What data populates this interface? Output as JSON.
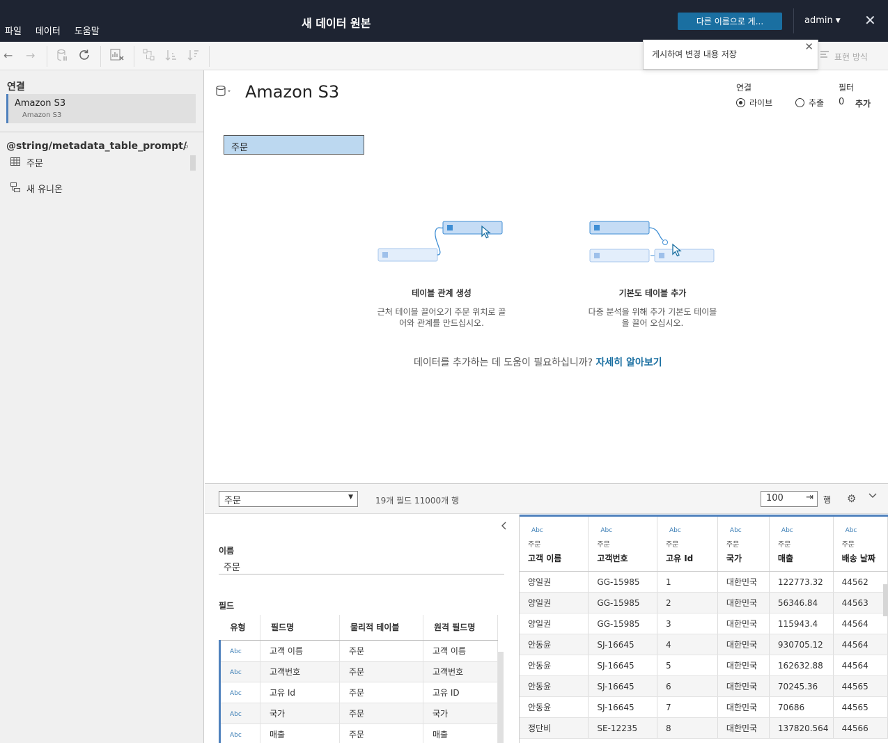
{
  "window": {
    "title": "새 데이터 원본",
    "menu": [
      "파일",
      "데이터",
      "도움말"
    ],
    "publish_button": "다른 이름으로 게...",
    "user": "admin"
  },
  "tooltip": {
    "text": "게시하여 변경 내용 저장"
  },
  "toolbar": {
    "presentation": "표현 방식"
  },
  "left_pane": {
    "connections_heading": "연결",
    "connection": {
      "name": "Amazon S3",
      "type": "Amazon S3"
    },
    "database": "@string/metadata_table_prompt/",
    "items": [
      {
        "label": "주문",
        "icon": "table-icon"
      },
      {
        "label": "새 유니온",
        "icon": "union-icon"
      }
    ]
  },
  "canvas": {
    "title": "Amazon S3",
    "connection_label": "연결",
    "connection_options": [
      {
        "label": "라이브",
        "selected": true
      },
      {
        "label": "추출",
        "selected": false
      }
    ],
    "filter_label": "필터",
    "filter_count": "0",
    "filter_add": "추가",
    "table_chip": "주문",
    "illustrations": [
      {
        "title": "테이블 관계 생성",
        "text_lines": [
          "근처 테이블 끌어오기 주문 위치로 끌",
          "어와 관계를 만드십시오."
        ]
      },
      {
        "title": "기본도 테이블 추가",
        "text_lines": [
          "다중 분석을 위해 추가 기본도 테이블",
          "을 끌어 오십시오."
        ]
      }
    ],
    "help_text": "데이터를 추가하는 데 도움이 필요하십니까?",
    "help_link": "자세히 알아보기"
  },
  "bottom_bar": {
    "table_select": "주문",
    "field_info": "19개 필드 11000개 행",
    "rows_value": "100",
    "rows_suffix": "행"
  },
  "metadata": {
    "name_label": "이름",
    "name_value": "주문",
    "fields_label": "필드",
    "columns": [
      "유형",
      "필드명",
      "물리적 테이블",
      "원격 필드명"
    ],
    "rows": [
      {
        "type": "Abc",
        "field": "고객 이름",
        "table": "주문",
        "remote": "고객 이름"
      },
      {
        "type": "Abc",
        "field": "고객번호",
        "table": "주문",
        "remote": "고객번호"
      },
      {
        "type": "Abc",
        "field": "고유 Id",
        "table": "주문",
        "remote": "고유 ID"
      },
      {
        "type": "Abc",
        "field": "국가",
        "table": "주문",
        "remote": "국가"
      },
      {
        "type": "Abc",
        "field": "매출",
        "table": "주문",
        "remote": "매출"
      }
    ]
  },
  "grid": {
    "columns": [
      {
        "type": "Abc",
        "table": "주문",
        "name": "고객 이름"
      },
      {
        "type": "Abc",
        "table": "주문",
        "name": "고객번호"
      },
      {
        "type": "Abc",
        "table": "주문",
        "name": "고유 Id"
      },
      {
        "type": "Abc",
        "table": "주문",
        "name": "국가"
      },
      {
        "type": "Abc",
        "table": "주문",
        "name": "매출"
      },
      {
        "type": "Abc",
        "table": "주문",
        "name": "배송 날짜"
      }
    ],
    "rows": [
      [
        "양일권",
        "GG-15985",
        "1",
        "대한민국",
        "122773.32",
        "44562"
      ],
      [
        "양일권",
        "GG-15985",
        "2",
        "대한민국",
        "56346.84",
        "44563"
      ],
      [
        "양일권",
        "GG-15985",
        "3",
        "대한민국",
        "115943.4",
        "44564"
      ],
      [
        "안동윤",
        "SJ-16645",
        "4",
        "대한민국",
        "930705.12",
        "44564"
      ],
      [
        "안동윤",
        "SJ-16645",
        "5",
        "대한민국",
        "162632.88",
        "44564"
      ],
      [
        "안동윤",
        "SJ-16645",
        "6",
        "대한민국",
        "70245.36",
        "44565"
      ],
      [
        "안동윤",
        "SJ-16645",
        "7",
        "대한민국",
        "70686",
        "44565"
      ],
      [
        "정단비",
        "SE-12235",
        "8",
        "대한민국",
        "137820.564",
        "44566"
      ]
    ]
  },
  "colors": {
    "topbar": "#1e2432",
    "accent": "#1a6fa1",
    "selection": "#4f81bd",
    "chip": "#bcd8f0"
  }
}
